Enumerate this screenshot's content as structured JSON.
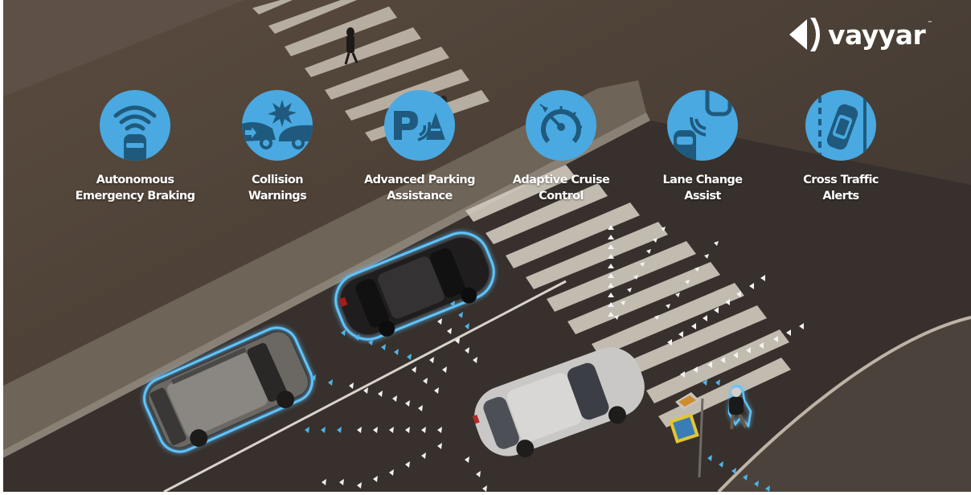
{
  "brand": {
    "name": "vayyar",
    "trademark": "™",
    "logo_icon": "vayyar-chevron-icon"
  },
  "features": [
    {
      "label": "Autonomous\nEmergency Braking",
      "icon": "emergency-braking-icon"
    },
    {
      "label": "Collision\nWarnings",
      "icon": "collision-warning-icon"
    },
    {
      "label": "Advanced Parking\nAssistance",
      "icon": "parking-assist-icon"
    },
    {
      "label": "Adaptive Cruise\nControl",
      "icon": "cruise-control-icon"
    },
    {
      "label": "Lane Change\nAssist",
      "icon": "lane-change-icon"
    },
    {
      "label": "Cross Traffic\nAlerts",
      "icon": "cross-traffic-icon"
    }
  ],
  "colors": {
    "icon_circle": "#4aa9e1",
    "icon_glyph": "#1f5a7e",
    "sensor_glow": "#5fc4ff",
    "road": "#3d3530",
    "crosswalk": "#cfc8bd"
  },
  "scene": {
    "description": "Aerial view of street intersection with cars and pedestrians detected by radar sensors",
    "objects": [
      "grey-suv",
      "black-sedan",
      "silver-sedan",
      "pedestrian",
      "pedestrian-crossing-sign"
    ]
  }
}
